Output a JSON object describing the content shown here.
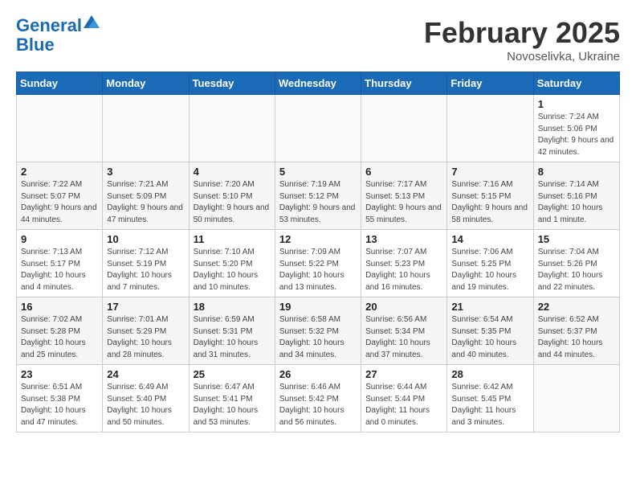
{
  "header": {
    "logo_line1": "General",
    "logo_line2": "Blue",
    "month": "February 2025",
    "location": "Novoselivka, Ukraine"
  },
  "weekdays": [
    "Sunday",
    "Monday",
    "Tuesday",
    "Wednesday",
    "Thursday",
    "Friday",
    "Saturday"
  ],
  "weeks": [
    [
      {
        "day": "",
        "info": ""
      },
      {
        "day": "",
        "info": ""
      },
      {
        "day": "",
        "info": ""
      },
      {
        "day": "",
        "info": ""
      },
      {
        "day": "",
        "info": ""
      },
      {
        "day": "",
        "info": ""
      },
      {
        "day": "1",
        "info": "Sunrise: 7:24 AM\nSunset: 5:06 PM\nDaylight: 9 hours and 42 minutes."
      }
    ],
    [
      {
        "day": "2",
        "info": "Sunrise: 7:22 AM\nSunset: 5:07 PM\nDaylight: 9 hours and 44 minutes."
      },
      {
        "day": "3",
        "info": "Sunrise: 7:21 AM\nSunset: 5:09 PM\nDaylight: 9 hours and 47 minutes."
      },
      {
        "day": "4",
        "info": "Sunrise: 7:20 AM\nSunset: 5:10 PM\nDaylight: 9 hours and 50 minutes."
      },
      {
        "day": "5",
        "info": "Sunrise: 7:19 AM\nSunset: 5:12 PM\nDaylight: 9 hours and 53 minutes."
      },
      {
        "day": "6",
        "info": "Sunrise: 7:17 AM\nSunset: 5:13 PM\nDaylight: 9 hours and 55 minutes."
      },
      {
        "day": "7",
        "info": "Sunrise: 7:16 AM\nSunset: 5:15 PM\nDaylight: 9 hours and 58 minutes."
      },
      {
        "day": "8",
        "info": "Sunrise: 7:14 AM\nSunset: 5:16 PM\nDaylight: 10 hours and 1 minute."
      }
    ],
    [
      {
        "day": "9",
        "info": "Sunrise: 7:13 AM\nSunset: 5:17 PM\nDaylight: 10 hours and 4 minutes."
      },
      {
        "day": "10",
        "info": "Sunrise: 7:12 AM\nSunset: 5:19 PM\nDaylight: 10 hours and 7 minutes."
      },
      {
        "day": "11",
        "info": "Sunrise: 7:10 AM\nSunset: 5:20 PM\nDaylight: 10 hours and 10 minutes."
      },
      {
        "day": "12",
        "info": "Sunrise: 7:09 AM\nSunset: 5:22 PM\nDaylight: 10 hours and 13 minutes."
      },
      {
        "day": "13",
        "info": "Sunrise: 7:07 AM\nSunset: 5:23 PM\nDaylight: 10 hours and 16 minutes."
      },
      {
        "day": "14",
        "info": "Sunrise: 7:06 AM\nSunset: 5:25 PM\nDaylight: 10 hours and 19 minutes."
      },
      {
        "day": "15",
        "info": "Sunrise: 7:04 AM\nSunset: 5:26 PM\nDaylight: 10 hours and 22 minutes."
      }
    ],
    [
      {
        "day": "16",
        "info": "Sunrise: 7:02 AM\nSunset: 5:28 PM\nDaylight: 10 hours and 25 minutes."
      },
      {
        "day": "17",
        "info": "Sunrise: 7:01 AM\nSunset: 5:29 PM\nDaylight: 10 hours and 28 minutes."
      },
      {
        "day": "18",
        "info": "Sunrise: 6:59 AM\nSunset: 5:31 PM\nDaylight: 10 hours and 31 minutes."
      },
      {
        "day": "19",
        "info": "Sunrise: 6:58 AM\nSunset: 5:32 PM\nDaylight: 10 hours and 34 minutes."
      },
      {
        "day": "20",
        "info": "Sunrise: 6:56 AM\nSunset: 5:34 PM\nDaylight: 10 hours and 37 minutes."
      },
      {
        "day": "21",
        "info": "Sunrise: 6:54 AM\nSunset: 5:35 PM\nDaylight: 10 hours and 40 minutes."
      },
      {
        "day": "22",
        "info": "Sunrise: 6:52 AM\nSunset: 5:37 PM\nDaylight: 10 hours and 44 minutes."
      }
    ],
    [
      {
        "day": "23",
        "info": "Sunrise: 6:51 AM\nSunset: 5:38 PM\nDaylight: 10 hours and 47 minutes."
      },
      {
        "day": "24",
        "info": "Sunrise: 6:49 AM\nSunset: 5:40 PM\nDaylight: 10 hours and 50 minutes."
      },
      {
        "day": "25",
        "info": "Sunrise: 6:47 AM\nSunset: 5:41 PM\nDaylight: 10 hours and 53 minutes."
      },
      {
        "day": "26",
        "info": "Sunrise: 6:46 AM\nSunset: 5:42 PM\nDaylight: 10 hours and 56 minutes."
      },
      {
        "day": "27",
        "info": "Sunrise: 6:44 AM\nSunset: 5:44 PM\nDaylight: 11 hours and 0 minutes."
      },
      {
        "day": "28",
        "info": "Sunrise: 6:42 AM\nSunset: 5:45 PM\nDaylight: 11 hours and 3 minutes."
      },
      {
        "day": "",
        "info": ""
      }
    ]
  ]
}
